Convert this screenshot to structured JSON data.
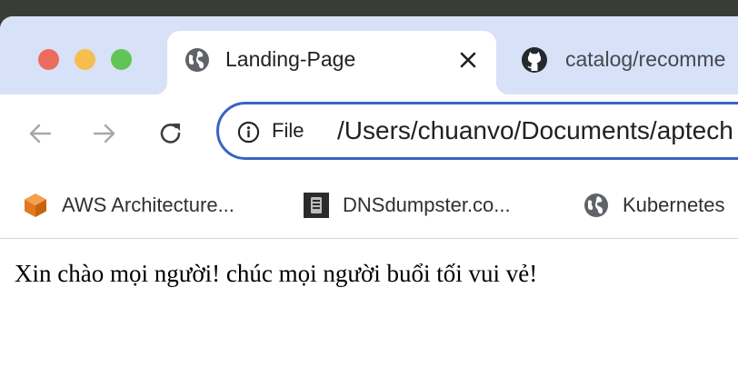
{
  "tabs": [
    {
      "title": "Landing-Page",
      "icon": "globe-icon",
      "active": true
    },
    {
      "title": "catalog/recomme",
      "icon": "github-icon",
      "active": false
    }
  ],
  "toolbar": {
    "omnibox": {
      "chip_label": "File",
      "url": "/Users/chuanvo/Documents/aptech"
    }
  },
  "bookmarks": [
    {
      "label": "AWS Architecture...",
      "icon": "aws-cube-icon"
    },
    {
      "label": "DNSdumpster.co...",
      "icon": "dnsdumpster-icon"
    },
    {
      "label": "Kubernetes",
      "icon": "globe-icon"
    }
  ],
  "page": {
    "body_text": "Xin chào mọi người! chúc mọi người buổi tối vui vẻ!"
  },
  "colors": {
    "tabstrip": "#d7e1f8",
    "omnibox_border": "#3a63c5",
    "traffic_red": "#ed6a5e",
    "traffic_yellow": "#f5bf4f",
    "traffic_green": "#61c454"
  }
}
